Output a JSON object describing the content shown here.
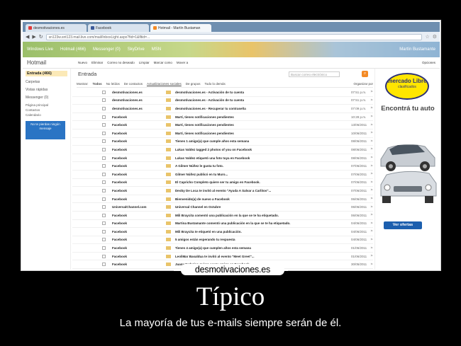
{
  "browser": {
    "tabs": [
      {
        "label": "desmotivaciones.es",
        "color": "#e03a3a"
      },
      {
        "label": "Facebook",
        "color": "#3b5998"
      },
      {
        "label": "Hotmail - Martín Bustaman",
        "color": "#f48a24"
      }
    ],
    "url": "sn123w.snt123.mail.live.com/mail/InboxLight.aspx?fid=1&fltid=..."
  },
  "hotmail": {
    "brand": "Hotmail",
    "header_links": [
      "Windows Live",
      "Hotmail (466)",
      "Messenger (0)",
      "SkyDrive",
      "MSN"
    ],
    "user": "Martín Bustamante",
    "toolbar": [
      "Nuevo",
      "Eliminar",
      "Correo no deseado",
      "Limpiar",
      "Marcar como",
      "Mover a"
    ],
    "options": "Opciones"
  },
  "sidebar": {
    "inbox": "Entrada (466)",
    "folders": [
      "Carpetas",
      "Vistas rápidas",
      "Messenger (0)"
    ],
    "links": [
      "Página principal",
      "Contactos",
      "Calendario"
    ],
    "ad_text": "No te pierdas ningún mensaje"
  },
  "main": {
    "title": "Entrada",
    "search_placeholder": "Buscar correo electrónico",
    "filters": [
      "Mostrar:",
      "Todos",
      "No leídos",
      "De contactos",
      "Actualizaciones sociales",
      "De grupos",
      "Todo lo demás"
    ],
    "organize": "Organizar por",
    "rows": [
      {
        "from": "desmotivaciones.es",
        "subject": "desmotivaciones.es - Activación de tu cuenta",
        "date": "07:51 p.m."
      },
      {
        "from": "desmotivaciones.es",
        "subject": "desmotivaciones.es - Activación de tu cuenta",
        "date": "07:51 p.m."
      },
      {
        "from": "desmotivaciones.es",
        "subject": "desmotivaciones.es - Recuperar tu contraseña",
        "date": "07:09 p.m."
      },
      {
        "from": "Facebook",
        "subject": "Martí, tienes notificaciones pendientes",
        "date": "10:28 p.m."
      },
      {
        "from": "Facebook",
        "subject": "Martí, tienes notificaciones pendientes",
        "date": "13/06/2011"
      },
      {
        "from": "Facebook",
        "subject": "Martí, tienes notificaciones pendientes",
        "date": "10/06/2011"
      },
      {
        "from": "Facebook",
        "subject": "Tienes 1 amigo(a) que cumple años esta semana",
        "date": "08/06/2011"
      },
      {
        "from": "Facebook",
        "subject": "Lukas Valdez tagged 2 photos of you on Facebook",
        "date": "08/06/2011"
      },
      {
        "from": "Facebook",
        "subject": "Lukas Valdez etiquetó una foto tuya en Facebook",
        "date": "08/06/2011"
      },
      {
        "from": "Facebook",
        "subject": "A Gilmer Núñez le gusta tu foto.",
        "date": "07/06/2011"
      },
      {
        "from": "Facebook",
        "subject": "Gilmer Núñez publicó en tu Muro...",
        "date": "07/06/2011"
      },
      {
        "from": "Facebook",
        "subject": "El Capricho Completo quiere ser tu amigo en Facebook.",
        "date": "07/06/2011"
      },
      {
        "from": "Facebook",
        "subject": "Deoby De Loca te invitó al evento \"Ayuda A Salvar a Carlitos\"...",
        "date": "07/06/2011"
      },
      {
        "from": "Facebook",
        "subject": "Bienvenido(a) de nuevo a Facebook",
        "date": "06/06/2011"
      },
      {
        "from": "UniversalChannel.com",
        "subject": "Universal Channel en Octubre",
        "date": "06/06/2011"
      },
      {
        "from": "Facebook",
        "subject": "Mili Braycita comentó una publicación en la que se te ha etiquetado.",
        "date": "06/06/2011"
      },
      {
        "from": "Facebook",
        "subject": "Martina Bustamante comentó una publicación en la que se te ha etiquetado.",
        "date": "04/06/2011"
      },
      {
        "from": "Facebook",
        "subject": "Mili Braycita te etiquetó en una publicación.",
        "date": "04/06/2011"
      },
      {
        "from": "Facebook",
        "subject": "5 amigos están esperando tu respuesta",
        "date": "04/06/2011"
      },
      {
        "from": "Facebook",
        "subject": "Tienes 4 amigo(a) que cumplen años esta semana",
        "date": "01/06/2011"
      },
      {
        "from": "Facebook",
        "subject": "LeoliMar Basaldua te invitó al evento \"Meet Greet\"...",
        "date": "01/06/2011"
      },
      {
        "from": "Facebook",
        "subject": "Juany Federico quiere ser tu amigo en Facebook.",
        "date": "30/05/2011"
      }
    ]
  },
  "ad": {
    "brand": "mercado Libre",
    "brand_sub": "clasificados",
    "headline": "Encontrá tu auto",
    "button": "Ver ofertas"
  },
  "watermark": "desmotivaciones.es",
  "caption": {
    "title": "Típico",
    "subtitle": "La mayoría de tus e-mails siempre serán de él."
  }
}
